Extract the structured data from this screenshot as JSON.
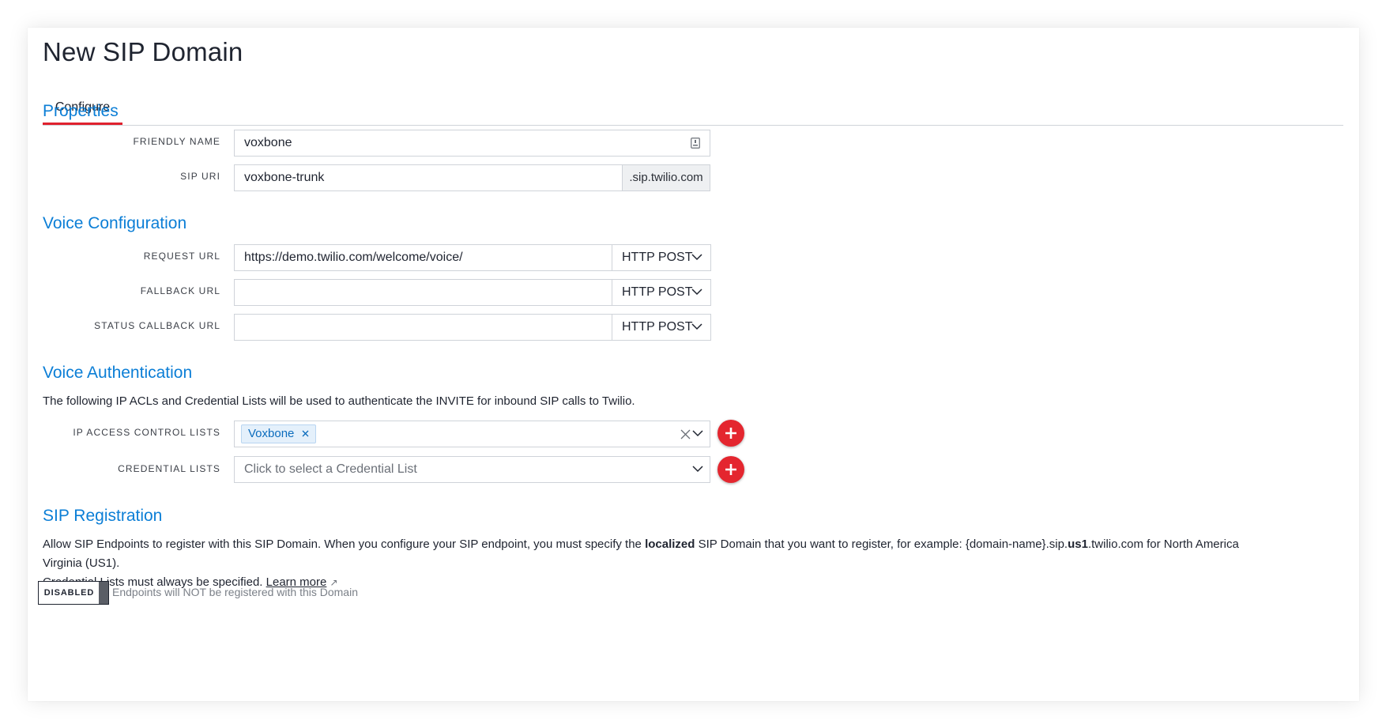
{
  "page": {
    "title": "New SIP Domain",
    "tabs": [
      {
        "label": "Configure",
        "active": true
      }
    ]
  },
  "properties": {
    "section_title": "Properties",
    "friendly_name": {
      "label": "FRIENDLY NAME",
      "value": "voxbone",
      "icon": "contact-card-icon"
    },
    "sip_uri": {
      "label": "SIP URI",
      "value": "voxbone-trunk",
      "suffix": ".sip.twilio.com"
    }
  },
  "voice_configuration": {
    "section_title": "Voice Configuration",
    "request_url": {
      "label": "REQUEST URL",
      "value": "https://demo.twilio.com/welcome/voice/",
      "method": "HTTP POST"
    },
    "fallback_url": {
      "label": "FALLBACK URL",
      "value": "",
      "method": "HTTP POST"
    },
    "status_callback_url": {
      "label": "STATUS CALLBACK URL",
      "value": "",
      "method": "HTTP POST"
    }
  },
  "voice_authentication": {
    "section_title": "Voice Authentication",
    "description": "The following IP ACLs and Credential Lists will be used to authenticate the INVITE for inbound SIP calls to Twilio.",
    "ip_access_control_lists": {
      "label": "IP ACCESS CONTROL LISTS",
      "selected": [
        "Voxbone"
      ]
    },
    "credential_lists": {
      "label": "CREDENTIAL LISTS",
      "placeholder": "Click to select a Credential List"
    }
  },
  "sip_registration": {
    "section_title": "SIP Registration",
    "desc_part1": "Allow SIP Endpoints to register with this SIP Domain. When you configure your SIP endpoint, you must specify the ",
    "desc_bold1": "localized",
    "desc_part2": " SIP Domain that you want to register, for example: {domain-name}.sip.",
    "desc_bold2": "us1",
    "desc_part3": ".twilio.com for North America Virginia (US1).",
    "desc_line2": "Credential Lists must always be specified. ",
    "learn_more": "Learn more",
    "learn_more_icon": "↗",
    "toggle_state": "DISABLED",
    "toggle_hint": "Endpoints will NOT be registered with this Domain"
  },
  "colors": {
    "accent_blue": "#0b7ed6",
    "tab_underline_red": "#e0212e",
    "add_button_red": "#e4262f"
  }
}
